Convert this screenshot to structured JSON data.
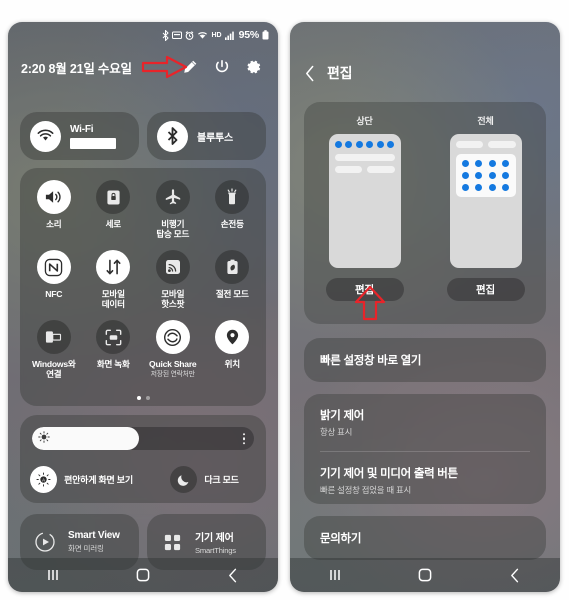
{
  "left_panel": {
    "status_bar": {
      "icons": [
        "bluetooth-icon",
        "screen-cast-icon",
        "alarm-icon",
        "wifi-icon",
        "hd-icon",
        "signal-bars-icon"
      ],
      "battery_percent": "95%"
    },
    "header": {
      "datetime": "2:20  8월 21일 수요일",
      "actions": [
        "pencil-edit-icon",
        "power-icon",
        "settings-gear-icon"
      ]
    },
    "connectivity": [
      {
        "label": "Wi-Fi",
        "icon": "wifi-icon",
        "state": "on",
        "value_redacted": true
      },
      {
        "label": "블루투스",
        "icon": "bluetooth-icon",
        "state": "on",
        "value_redacted": false
      }
    ],
    "tiles": [
      {
        "label": "소리",
        "sub": "",
        "icon": "volume-icon",
        "state": "on"
      },
      {
        "label": "세로",
        "sub": "",
        "icon": "rotation-lock-icon",
        "state": "off"
      },
      {
        "label": "비행기\n탑승 모드",
        "sub": "",
        "icon": "airplane-icon",
        "state": "off"
      },
      {
        "label": "손전등",
        "sub": "",
        "icon": "flashlight-icon",
        "state": "off"
      },
      {
        "label": "NFC",
        "sub": "",
        "icon": "nfc-icon",
        "state": "on"
      },
      {
        "label": "모바일\n데이터",
        "sub": "",
        "icon": "mobile-data-icon",
        "state": "on"
      },
      {
        "label": "모바일\n핫스팟",
        "sub": "",
        "icon": "hotspot-icon",
        "state": "off"
      },
      {
        "label": "절전 모드",
        "sub": "",
        "icon": "power-saving-icon",
        "state": "off"
      },
      {
        "label": "Windows와\n연결",
        "sub": "",
        "icon": "link-to-windows-icon",
        "state": "off"
      },
      {
        "label": "화면 녹화",
        "sub": "",
        "icon": "screen-record-icon",
        "state": "off"
      },
      {
        "label": "Quick Share",
        "sub": "저장된 연락처만",
        "icon": "quick-share-icon",
        "state": "on"
      },
      {
        "label": "위치",
        "sub": "",
        "icon": "location-pin-icon",
        "state": "on"
      }
    ],
    "pager": {
      "count": 2,
      "active": 0
    },
    "brightness": {
      "level_percent": 48,
      "slider_icon": "brightness-sun-icon",
      "more_icon": "more-vertical-icon",
      "options": [
        {
          "label": "편안하게 화면 보기",
          "icon": "eye-comfort-icon",
          "state": "on"
        },
        {
          "label": "다크 모드",
          "icon": "moon-icon",
          "state": "off"
        }
      ]
    },
    "media": [
      {
        "title": "Smart View",
        "sub": "화면 미러링",
        "icon": "smart-view-icon"
      },
      {
        "title": "기기 제어",
        "sub": "SmartThings",
        "icon": "device-control-icon"
      }
    ],
    "nav": [
      {
        "name": "recents-button",
        "icon": "recents-icon"
      },
      {
        "name": "home-button",
        "icon": "home-icon"
      },
      {
        "name": "back-button",
        "icon": "back-icon"
      }
    ]
  },
  "right_panel": {
    "header": {
      "back_icon": "chevron-left-icon",
      "title": "편집"
    },
    "previews": [
      {
        "caption": "상단",
        "button_label": "편집",
        "layout": "top"
      },
      {
        "caption": "전체",
        "button_label": "편집",
        "layout": "full"
      }
    ],
    "options": [
      {
        "title": "빠른 설정창 바로 열기",
        "sub": ""
      },
      {
        "title": "밝기 제어",
        "sub": "항상 표시"
      },
      {
        "title": "기기 제어 및 미디어 출력 버튼",
        "sub": "빠른 설정창 접었을 때 표시"
      },
      {
        "title": "문의하기",
        "sub": ""
      }
    ],
    "nav": [
      {
        "name": "recents-button",
        "icon": "recents-icon"
      },
      {
        "name": "home-button",
        "icon": "home-icon"
      },
      {
        "name": "back-button",
        "icon": "back-icon"
      }
    ]
  },
  "annotations": [
    {
      "name": "arrow-to-pencil-edit",
      "direction": "right",
      "color": "#e8242a"
    },
    {
      "name": "arrow-to-top-edit-button",
      "direction": "up",
      "color": "#e8242a"
    }
  ],
  "theme": {
    "accent_blue": "#1479e0",
    "annotation_red": "#e8242a",
    "tile_on_bg": "#ffffff"
  }
}
